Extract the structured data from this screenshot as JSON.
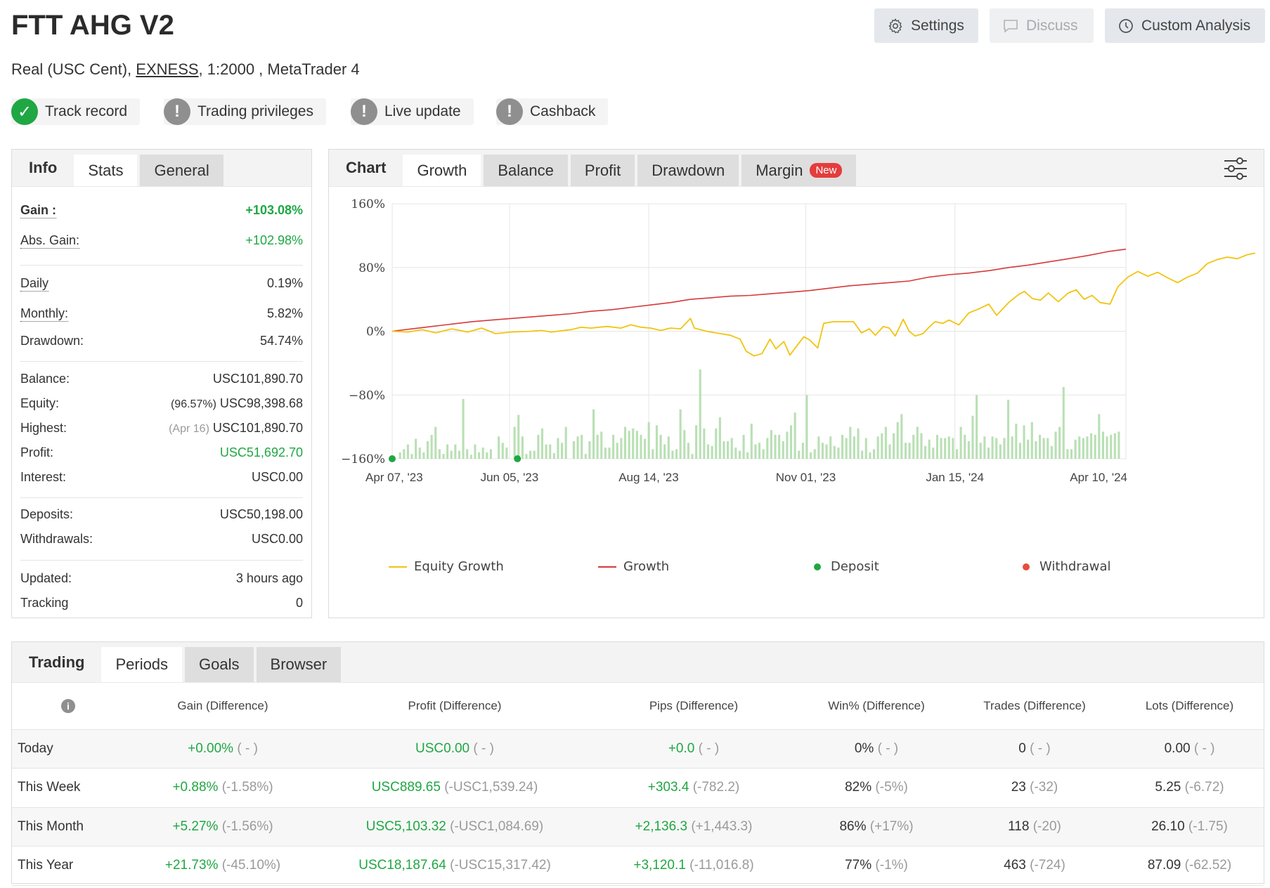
{
  "header": {
    "title": "FTT AHG V2",
    "subtitle_prefix": "Real (USC Cent), ",
    "subtitle_broker": "EXNESS",
    "subtitle_suffix": ", 1:2000 , MetaTrader 4",
    "buttons": {
      "settings": "Settings",
      "discuss": "Discuss",
      "custom_analysis": "Custom Analysis"
    }
  },
  "badges": [
    {
      "label": "Track record",
      "status": "ok"
    },
    {
      "label": "Trading privileges",
      "status": "warn"
    },
    {
      "label": "Live update",
      "status": "warn"
    },
    {
      "label": "Cashback",
      "status": "warn"
    }
  ],
  "info_panel": {
    "tabs": {
      "info": "Info",
      "stats": "Stats",
      "general": "General"
    },
    "gain": {
      "label": "Gain :",
      "value": "+103.08%"
    },
    "abs_gain": {
      "label": "Abs. Gain:",
      "value": "+102.98%"
    },
    "daily": {
      "label": "Daily",
      "value": "0.19%"
    },
    "monthly": {
      "label": "Monthly:",
      "value": "5.82%"
    },
    "drawdown": {
      "label": "Drawdown:",
      "value": "54.74%"
    },
    "balance": {
      "label": "Balance:",
      "value": "USC101,890.70"
    },
    "equity": {
      "label": "Equity:",
      "note": "(96.57%)",
      "value": "USC98,398.68"
    },
    "highest": {
      "label": "Highest:",
      "note": "(Apr 16)",
      "value": "USC101,890.70"
    },
    "profit": {
      "label": "Profit:",
      "value": "USC51,692.70"
    },
    "interest": {
      "label": "Interest:",
      "value": "USC0.00"
    },
    "deposits": {
      "label": "Deposits:",
      "value": "USC50,198.00"
    },
    "withdrawals": {
      "label": "Withdrawals:",
      "value": "USC0.00"
    },
    "updated": {
      "label": "Updated:",
      "value": "3 hours ago"
    },
    "tracking": {
      "label": "Tracking",
      "value": "0"
    }
  },
  "chart_panel": {
    "tabs": {
      "chart": "Chart",
      "growth": "Growth",
      "balance": "Balance",
      "profit": "Profit",
      "drawdown": "Drawdown",
      "margin": "Margin",
      "new_badge": "New"
    },
    "settings_icon": "sliders-icon"
  },
  "chart_data": {
    "type": "line",
    "ylim": [
      -160,
      160
    ],
    "y_ticks": [
      "160%",
      "80%",
      "0%",
      "−80%",
      "−160%"
    ],
    "y_tick_values": [
      160,
      80,
      0,
      -80,
      -160
    ],
    "x_ticks": [
      "Apr 07, '23",
      "Jun 05, '23",
      "Aug 14, '23",
      "Nov 01, '23",
      "Jan 15, '24",
      "Apr 10, '24"
    ],
    "x_range": [
      "2023-04-07",
      "2024-04-10"
    ],
    "grid": true,
    "legend": [
      {
        "name": "Equity Growth",
        "color": "#f1c40f",
        "kind": "line"
      },
      {
        "name": "Growth",
        "color": "#d63a3a",
        "kind": "line"
      },
      {
        "name": "Deposit",
        "color": "#1fa743",
        "kind": "dot"
      },
      {
        "name": "Withdrawal",
        "color": "#e74c3c",
        "kind": "dot"
      }
    ],
    "series": [
      {
        "name": "Growth",
        "color": "#d63a3a",
        "points": [
          [
            0,
            0
          ],
          [
            10,
            3
          ],
          [
            20,
            6
          ],
          [
            30,
            9
          ],
          [
            40,
            12
          ],
          [
            50,
            14
          ],
          [
            60,
            16
          ],
          [
            70,
            18
          ],
          [
            80,
            20
          ],
          [
            90,
            22
          ],
          [
            100,
            25
          ],
          [
            110,
            27
          ],
          [
            120,
            30
          ],
          [
            130,
            33
          ],
          [
            140,
            36
          ],
          [
            150,
            40
          ],
          [
            160,
            42
          ],
          [
            170,
            44
          ],
          [
            180,
            45
          ],
          [
            190,
            47
          ],
          [
            200,
            49
          ],
          [
            210,
            51
          ],
          [
            220,
            54
          ],
          [
            230,
            57
          ],
          [
            240,
            59
          ],
          [
            250,
            61
          ],
          [
            260,
            63
          ],
          [
            270,
            68
          ],
          [
            280,
            71
          ],
          [
            290,
            73
          ],
          [
            300,
            76
          ],
          [
            310,
            80
          ],
          [
            320,
            83
          ],
          [
            330,
            87
          ],
          [
            340,
            91
          ],
          [
            350,
            95
          ],
          [
            360,
            100
          ],
          [
            369,
            103
          ]
        ]
      },
      {
        "name": "Equity Growth",
        "color": "#f1c40f",
        "points": [
          [
            0,
            0
          ],
          [
            8,
            -1
          ],
          [
            15,
            2
          ],
          [
            22,
            -2
          ],
          [
            30,
            3
          ],
          [
            38,
            -1
          ],
          [
            45,
            4
          ],
          [
            52,
            -3
          ],
          [
            60,
            -1
          ],
          [
            70,
            0
          ],
          [
            75,
            1
          ],
          [
            80,
            -1
          ],
          [
            90,
            2
          ],
          [
            95,
            5
          ],
          [
            100,
            4
          ],
          [
            108,
            6
          ],
          [
            115,
            4
          ],
          [
            120,
            8
          ],
          [
            125,
            5
          ],
          [
            130,
            4
          ],
          [
            135,
            1
          ],
          [
            140,
            4
          ],
          [
            145,
            3
          ],
          [
            150,
            16
          ],
          [
            152,
            4
          ],
          [
            158,
            0
          ],
          [
            165,
            -3
          ],
          [
            170,
            -5
          ],
          [
            175,
            -10
          ],
          [
            178,
            -25
          ],
          [
            182,
            -31
          ],
          [
            186,
            -28
          ],
          [
            190,
            -10
          ],
          [
            193,
            -22
          ],
          [
            197,
            -13
          ],
          [
            200,
            -30
          ],
          [
            203,
            -20
          ],
          [
            207,
            -7
          ],
          [
            210,
            -11
          ],
          [
            214,
            -21
          ],
          [
            217,
            10
          ],
          [
            222,
            12
          ],
          [
            228,
            12
          ],
          [
            232,
            12
          ],
          [
            236,
            -2
          ],
          [
            240,
            3
          ],
          [
            243,
            -5
          ],
          [
            247,
            6
          ],
          [
            250,
            4
          ],
          [
            253,
            -6
          ],
          [
            257,
            15
          ],
          [
            260,
            0
          ],
          [
            263,
            -6
          ],
          [
            267,
            -3
          ],
          [
            270,
            5
          ],
          [
            273,
            12
          ],
          [
            277,
            10
          ],
          [
            280,
            14
          ],
          [
            285,
            8
          ],
          [
            290,
            23
          ],
          [
            295,
            28
          ],
          [
            300,
            34
          ],
          [
            304,
            20
          ],
          [
            310,
            36
          ],
          [
            315,
            46
          ],
          [
            318,
            50
          ],
          [
            322,
            41
          ],
          [
            326,
            39
          ],
          [
            330,
            48
          ],
          [
            335,
            37
          ],
          [
            340,
            48
          ],
          [
            344,
            52
          ],
          [
            348,
            40
          ],
          [
            352,
            45
          ],
          [
            356,
            36
          ],
          [
            361,
            34
          ],
          [
            365,
            56
          ],
          [
            370,
            68
          ],
          [
            375,
            75
          ],
          [
            380,
            69
          ],
          [
            385,
            74
          ],
          [
            390,
            67
          ],
          [
            395,
            61
          ],
          [
            400,
            68
          ],
          [
            405,
            73
          ],
          [
            410,
            85
          ],
          [
            415,
            90
          ],
          [
            420,
            93
          ],
          [
            425,
            91
          ],
          [
            430,
            96
          ],
          [
            434,
            98
          ]
        ]
      }
    ],
    "bars": [
      0,
      8,
      12,
      18,
      6,
      25,
      14,
      8,
      22,
      30,
      40,
      12,
      6,
      18,
      10,
      18,
      10,
      75,
      12,
      5,
      18,
      8,
      14,
      8,
      12,
      0,
      28,
      20,
      14,
      0,
      40,
      55,
      28,
      6,
      10,
      10,
      30,
      38,
      18,
      18,
      7,
      26,
      20,
      40,
      0,
      22,
      28,
      30,
      6,
      22,
      62,
      30,
      34,
      14,
      14,
      30,
      20,
      26,
      40,
      35,
      38,
      35,
      30,
      25,
      46,
      12,
      42,
      30,
      18,
      28,
      10,
      12,
      62,
      36,
      20,
      6,
      42,
      112,
      38,
      18,
      16,
      38,
      52,
      22,
      22,
      26,
      14,
      10,
      30,
      8,
      44,
      18,
      20,
      12,
      26,
      36,
      30,
      30,
      22,
      34,
      42,
      58,
      10,
      20,
      80,
      8,
      12,
      28,
      20,
      18,
      28,
      16,
      14,
      30,
      26,
      40,
      28,
      38,
      10,
      26,
      8,
      12,
      28,
      32,
      40,
      18,
      32,
      46,
      56,
      20,
      20,
      30,
      40,
      32,
      16,
      24,
      14,
      30,
      26,
      26,
      28,
      26,
      12,
      40,
      30,
      22,
      54,
      80,
      20,
      28,
      14,
      28,
      26,
      18,
      26,
      74,
      28,
      44,
      20,
      42,
      24,
      46,
      22,
      30,
      26,
      26,
      16,
      34,
      40,
      90,
      12,
      12,
      24,
      28,
      26,
      28,
      32,
      30,
      56,
      34,
      28,
      30,
      32,
      34
    ],
    "deposits_x": [
      0,
      63
    ]
  },
  "periods_panel": {
    "tabs": {
      "trading": "Trading",
      "periods": "Periods",
      "goals": "Goals",
      "browser": "Browser"
    },
    "columns": [
      "Gain (Difference)",
      "Profit (Difference)",
      "Pips (Difference)",
      "Win% (Difference)",
      "Trades (Difference)",
      "Lots (Difference)"
    ],
    "rows": [
      {
        "period": "Today",
        "gain": "+0.00%",
        "gain_diff": "( - )",
        "profit": "USC0.00",
        "profit_diff": "( - )",
        "pips": "+0.0",
        "pips_diff": "( - )",
        "win": "0%",
        "win_diff": "( - )",
        "trades": "0",
        "trades_diff": "( - )",
        "lots": "0.00",
        "lots_diff": "( - )"
      },
      {
        "period": "This Week",
        "gain": "+0.88%",
        "gain_diff": "(-1.58%)",
        "profit": "USC889.65",
        "profit_diff": "(-USC1,539.24)",
        "pips": "+303.4",
        "pips_diff": "(-782.2)",
        "win": "82%",
        "win_diff": "(-5%)",
        "trades": "23",
        "trades_diff": "(-32)",
        "lots": "5.25",
        "lots_diff": "(-6.72)"
      },
      {
        "period": "This Month",
        "gain": "+5.27%",
        "gain_diff": "(-1.56%)",
        "profit": "USC5,103.32",
        "profit_diff": "(-USC1,084.69)",
        "pips": "+2,136.3",
        "pips_diff": "(+1,443.3)",
        "win": "86%",
        "win_diff": "(+17%)",
        "trades": "118",
        "trades_diff": "(-20)",
        "lots": "26.10",
        "lots_diff": "(-1.75)"
      },
      {
        "period": "This Year",
        "gain": "+21.73%",
        "gain_diff": "(-45.10%)",
        "profit": "USC18,187.64",
        "profit_diff": "(-USC15,317.42)",
        "pips": "+3,120.1",
        "pips_diff": "(-11,016.8)",
        "win": "77%",
        "win_diff": "(-1%)",
        "trades": "463",
        "trades_diff": "(-724)",
        "lots": "87.09",
        "lots_diff": "(-62.52)"
      }
    ]
  }
}
